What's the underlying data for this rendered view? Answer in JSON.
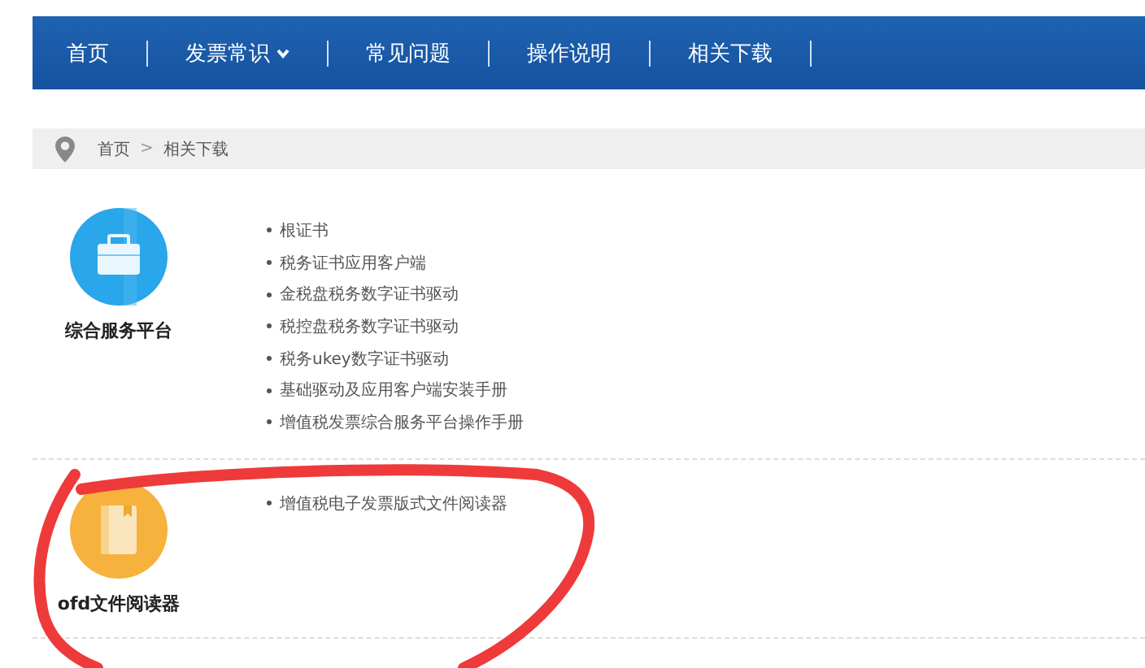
{
  "nav": [
    {
      "label": "首页",
      "dropdown": false
    },
    {
      "label": "发票常识",
      "dropdown": true
    },
    {
      "label": "常见问题",
      "dropdown": false
    },
    {
      "label": "操作说明",
      "dropdown": false
    },
    {
      "label": "相关下载",
      "dropdown": false
    }
  ],
  "breadcrumb": {
    "home": "首页",
    "separator": ">",
    "current": "相关下载"
  },
  "sections": [
    {
      "kind": "briefcase",
      "title": "综合服务平台",
      "items": [
        "根证书",
        "税务证书应用客户端",
        "金税盘税务数字证书驱动",
        "税控盘税务数字证书驱动",
        "税务ukey数字证书驱动",
        "基础驱动及应用客户端安装手册",
        "增值税发票综合服务平台操作手册"
      ]
    },
    {
      "kind": "book",
      "title": "ofd文件阅读器",
      "items": [
        "增值税电子发票版式文件阅读器"
      ]
    }
  ]
}
